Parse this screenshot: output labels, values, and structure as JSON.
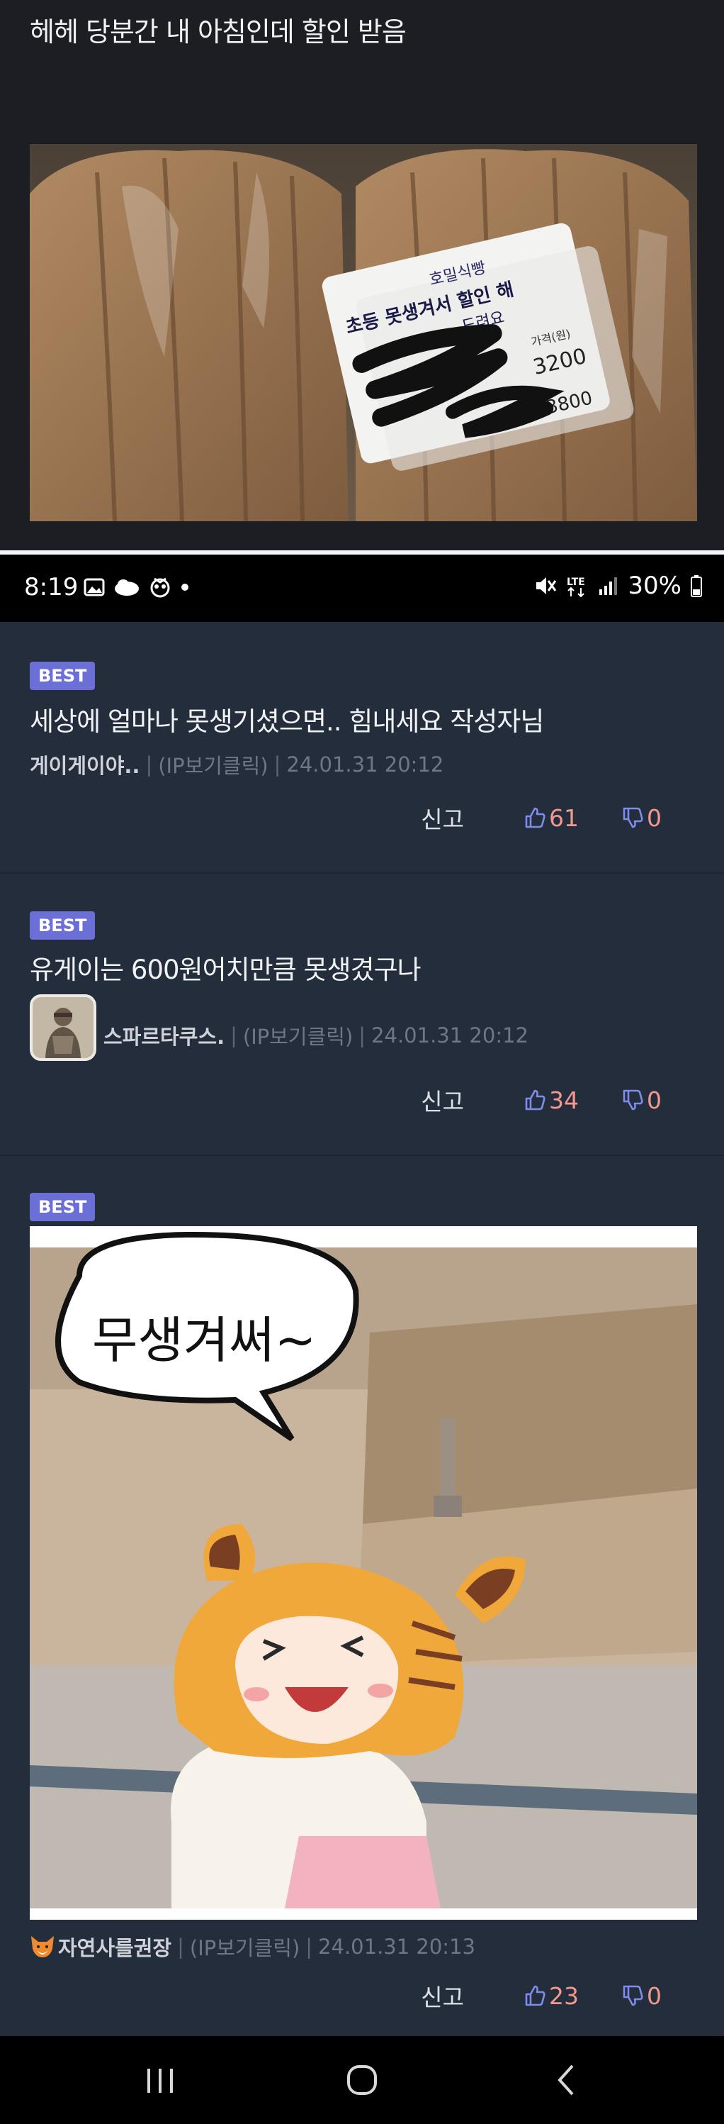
{
  "post": {
    "title": "헤헤 당분간 내 아침인데 할인 받음"
  },
  "photo": {
    "label_lines": [
      "호밀식빵",
      "초등 못생겨서 할인 해",
      "드려요"
    ],
    "price_label": "가격(원)",
    "price": "3200",
    "old_price": "3800"
  },
  "status_bar": {
    "time": "8:19",
    "battery": "30%",
    "network": "LTE"
  },
  "comments": [
    {
      "badge": "BEST",
      "text": "세상에 얼마나 못생기셨으면.. 힘내세요 작성자님",
      "nickname": "게이게이야..",
      "ip": "(IP보기클릭)",
      "date": "24.01.31 20:12",
      "report": "신고",
      "likes": "61",
      "dislikes": "0"
    },
    {
      "badge": "BEST",
      "text": "유게이는 600원어치만큼 못생겼구나",
      "nickname": "스파르타쿠스.",
      "ip": "(IP보기클릭)",
      "date": "24.01.31 20:12",
      "report": "신고",
      "likes": "34",
      "dislikes": "0"
    },
    {
      "badge": "BEST",
      "image_text": "무생겨써~",
      "nickname": "자연사를권장",
      "ip": "(IP보기클릭)",
      "date": "24.01.31 20:13",
      "report": "신고",
      "likes": "23",
      "dislikes": "0"
    }
  ],
  "colors": {
    "badge": "#6b6fd6",
    "comment_bg": "#232d3b",
    "count": "#f2998f",
    "thumb_icon": "#7f8ce8"
  }
}
